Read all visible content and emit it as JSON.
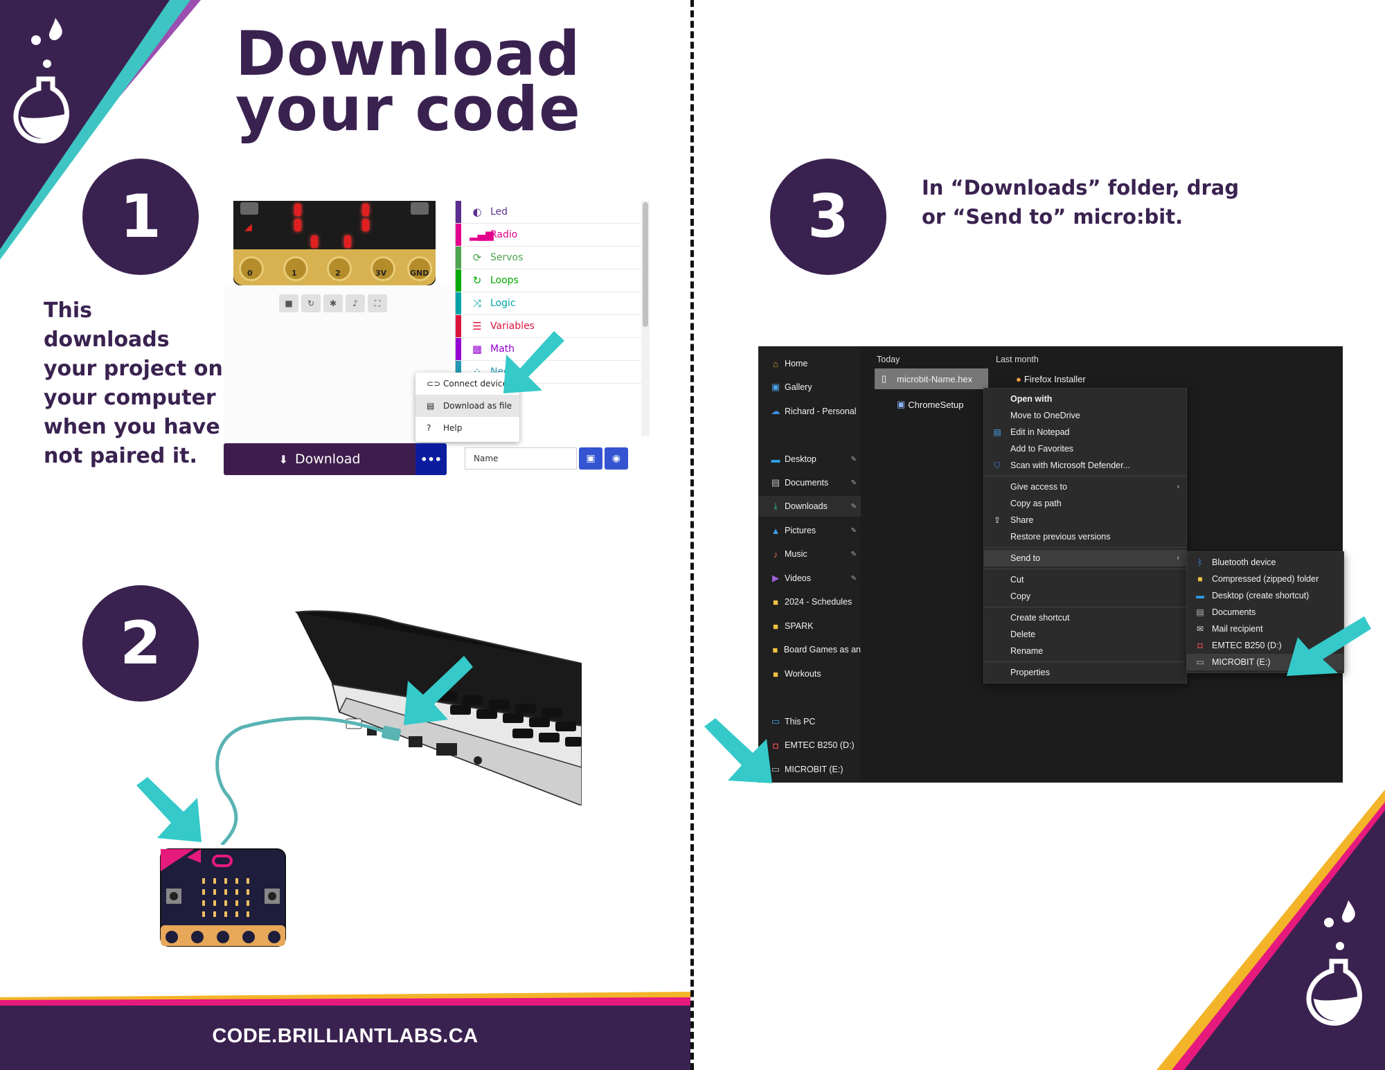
{
  "title": {
    "line1": "Download",
    "line2": "your code"
  },
  "steps": [
    {
      "number": "1",
      "note": [
        "This downloads",
        "your project on",
        "your computer",
        "when you have",
        "not paired it."
      ]
    },
    {
      "number": "2"
    },
    {
      "number": "3",
      "instruction": [
        "In “Downloads” folder, drag",
        "or “Send to” micro:bit."
      ]
    }
  ],
  "makecode": {
    "pins": [
      "0",
      "1",
      "2",
      "3V",
      "GND"
    ],
    "toolbox": [
      {
        "label": "Led",
        "color": "#5c2d91",
        "icon": "toggle-icon"
      },
      {
        "label": "Radio",
        "color": "#e3008c",
        "icon": "signal-icon"
      },
      {
        "label": "Servos",
        "color": "#4ea34e",
        "icon": "refresh-icon"
      },
      {
        "label": "Loops",
        "color": "#00aa00",
        "icon": "loop-icon"
      },
      {
        "label": "Logic",
        "color": "#00a4a6",
        "icon": "shuffle-icon"
      },
      {
        "label": "Variables",
        "color": "#dc143c",
        "icon": "list-icon"
      },
      {
        "label": "Math",
        "color": "#9400d3",
        "icon": "calculator-icon"
      },
      {
        "label": "Neopi",
        "color": "#2699b4",
        "icon": "spinner-icon"
      }
    ],
    "menu": [
      {
        "label": "Connect device",
        "icon": "link-icon"
      },
      {
        "label": "Download as file",
        "icon": "file-icon"
      },
      {
        "label": "Help",
        "icon": "question-icon"
      }
    ],
    "download_label": "Download",
    "more_label": "•••",
    "name_placeholder": "Name"
  },
  "explorer": {
    "nav": [
      {
        "label": "Home",
        "icon": "home-icon"
      },
      {
        "label": "Gallery",
        "icon": "gallery-icon"
      },
      {
        "label": "Richard - Personal",
        "icon": "cloud-icon"
      },
      {
        "label": "Desktop",
        "icon": "desktop-icon",
        "pinned": true
      },
      {
        "label": "Documents",
        "icon": "documents-icon",
        "pinned": true
      },
      {
        "label": "Downloads",
        "icon": "download-icon",
        "pinned": true
      },
      {
        "label": "Pictures",
        "icon": "pictures-icon",
        "pinned": true
      },
      {
        "label": "Music",
        "icon": "music-icon",
        "pinned": true
      },
      {
        "label": "Videos",
        "icon": "video-icon",
        "pinned": true
      },
      {
        "label": "2024 - Schedules",
        "icon": "folder-icon"
      },
      {
        "label": "SPARK",
        "icon": "folder-icon"
      },
      {
        "label": "Board Games as an",
        "icon": "folder-icon"
      },
      {
        "label": "Workouts",
        "icon": "folder-icon"
      },
      {
        "label": "This PC",
        "icon": "pc-icon"
      },
      {
        "label": "EMTEC B250 (D:)",
        "icon": "usb-drive-icon"
      },
      {
        "label": "MICROBIT (E:)",
        "icon": "drive-icon"
      }
    ],
    "groups": {
      "today": "Today",
      "last_month": "Last month"
    },
    "files": {
      "hex": "microbit-Name.hex",
      "chrome": "ChromeSetup",
      "firefox": "Firefox Installer"
    },
    "context_menu": [
      [
        "Open with",
        "Move to OneDrive",
        "Edit in Notepad",
        "Add to Favorites",
        "Scan with Microsoft Defender..."
      ],
      [
        "Give access to",
        "Copy as path",
        "Share",
        "Restore previous versions"
      ],
      [
        "Send to"
      ],
      [
        "Cut",
        "Copy"
      ],
      [
        "Create shortcut",
        "Delete",
        "Rename"
      ],
      [
        "Properties"
      ]
    ],
    "send_to": [
      "Bluetooth device",
      "Compressed (zipped) folder",
      "Desktop (create shortcut)",
      "Documents",
      "Mail recipient",
      "EMTEC B250 (D:)",
      "MICROBIT (E:)"
    ]
  },
  "footer": "CODE.BRILLIANTLABS.CA",
  "colors": {
    "purple": "#3a2250",
    "teal": "#35c9c9",
    "pink": "#e6197d",
    "gold": "#f3b429"
  }
}
